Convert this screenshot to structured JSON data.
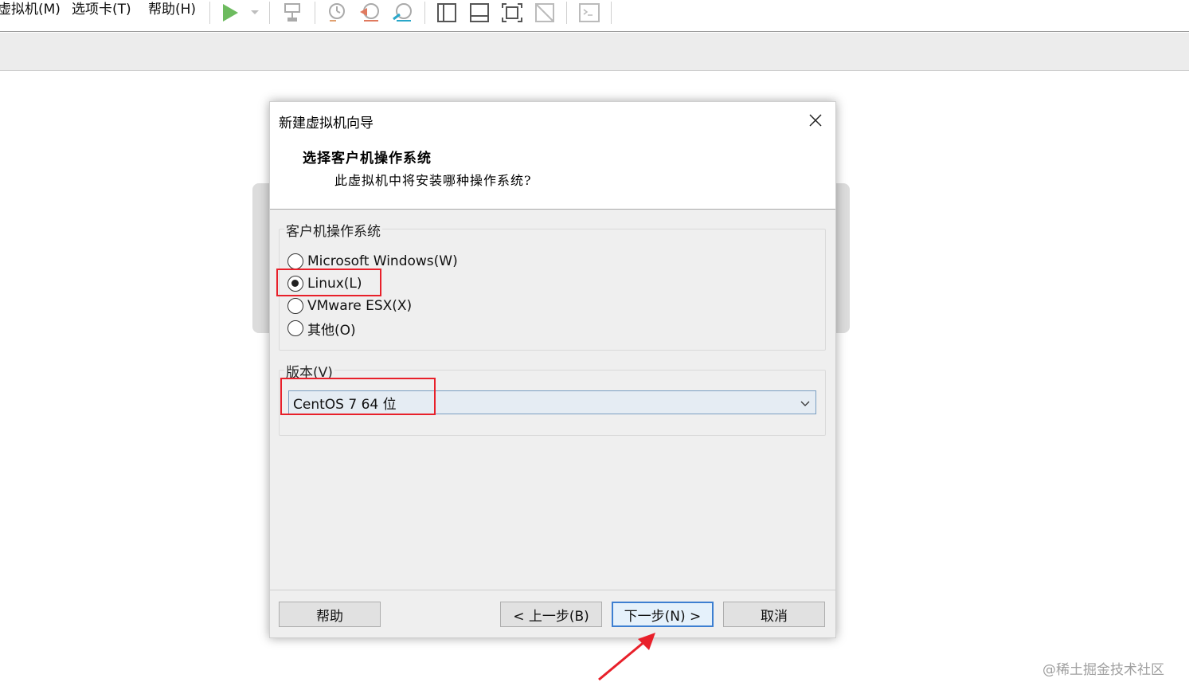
{
  "menu": {
    "items": [
      "虚拟机(M)",
      "选项卡(T)",
      "帮助(H)"
    ]
  },
  "toolbar": {
    "icons": [
      "play-icon",
      "dropdown-icon",
      "network-icon",
      "snapshot-icon",
      "revert-snapshot-icon",
      "manage-snapshots-icon",
      "sidebar-view-icon",
      "thumbnail-view-icon",
      "fullscreen-icon",
      "unity-icon",
      "console-icon"
    ]
  },
  "dialog": {
    "title": "新建虚拟机向导",
    "heading": "选择客户机操作系统",
    "subheading": "此虚拟机中将安装哪种操作系统?",
    "os_group": {
      "label": "客户机操作系统",
      "options": [
        {
          "label": "Microsoft Windows(W)",
          "checked": false
        },
        {
          "label": "Linux(L)",
          "checked": true
        },
        {
          "label": "VMware ESX(X)",
          "checked": false
        },
        {
          "label": "其他(O)",
          "checked": false
        }
      ]
    },
    "version_group": {
      "label": "版本(V)",
      "selected": "CentOS 7 64 位"
    },
    "buttons": {
      "help": "帮助",
      "back": "< 上一步(B)",
      "next": "下一步(N) >",
      "cancel": "取消"
    }
  },
  "colors": {
    "highlight": "#e8202a",
    "accent": "#3d7fd1",
    "play": "#5cb85c"
  },
  "watermark": "@稀土掘金技术社区"
}
